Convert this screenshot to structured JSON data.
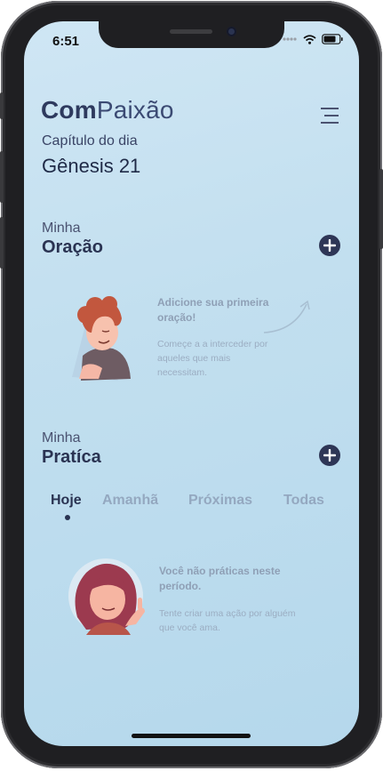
{
  "status_bar": {
    "time": "6:51"
  },
  "header": {
    "logo_bold": "Com",
    "logo_light": "Paixão",
    "chapter_label": "Capítulo do dia",
    "chapter_value": "Gênesis 21"
  },
  "prayer": {
    "small_label": "Minha",
    "title": "Oração",
    "empty_title": "Adicione sua primeira oração!",
    "empty_text": "Começe a a interceder por aqueles que mais necessitam."
  },
  "practice": {
    "small_label": "Minha",
    "title": "Pratíca",
    "tabs": [
      "Hoje",
      "Amanhã",
      "Próximas",
      "Todas"
    ],
    "active_tab": "Hoje",
    "empty_title": "Você não práticas neste período.",
    "empty_text": "Tente criar uma ação por alguém que você ama."
  },
  "colors": {
    "accent": "#2e3656",
    "background": "#c2dfef",
    "muted_text": "#8fa0b6"
  },
  "icons": {
    "menu": "hamburger-menu-icon",
    "add": "plus-circle-icon",
    "wifi": "wifi-icon",
    "battery": "battery-icon",
    "signal": "cellular-signal-icon"
  }
}
